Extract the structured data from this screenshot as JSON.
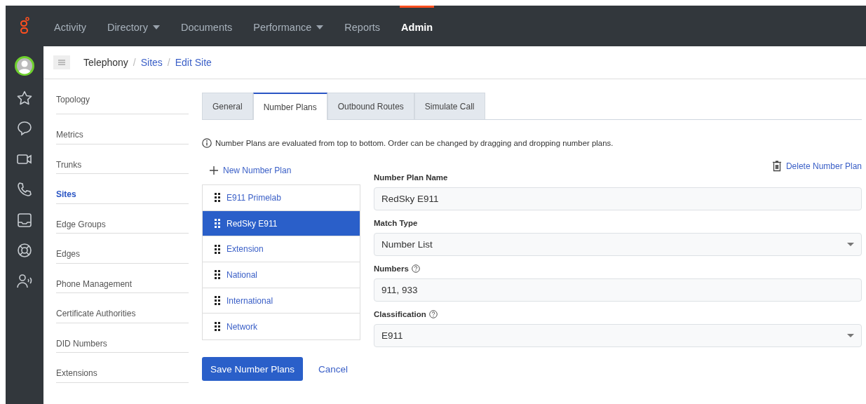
{
  "top_nav": [
    {
      "label": "Activity",
      "dropdown": false,
      "selected": false
    },
    {
      "label": "Directory",
      "dropdown": true,
      "selected": false
    },
    {
      "label": "Documents",
      "dropdown": false,
      "selected": false
    },
    {
      "label": "Performance",
      "dropdown": true,
      "selected": false
    },
    {
      "label": "Reports",
      "dropdown": false,
      "selected": false
    },
    {
      "label": "Admin",
      "dropdown": false,
      "selected": true
    }
  ],
  "breadcrumb": [
    {
      "label": "Telephony",
      "kind": "text"
    },
    {
      "label": "/",
      "kind": "separator"
    },
    {
      "label": "Sites",
      "kind": "link"
    },
    {
      "label": "/",
      "kind": "separator"
    },
    {
      "label": "Edit Site",
      "kind": "link"
    }
  ],
  "sidebar": {
    "items": [
      {
        "label": "Topology",
        "selected": false
      },
      {
        "label": "Metrics",
        "selected": false
      },
      {
        "label": "Trunks",
        "selected": false
      },
      {
        "label": "Sites",
        "selected": true
      },
      {
        "label": "Edge Groups",
        "selected": false
      },
      {
        "label": "Edges",
        "selected": false
      },
      {
        "label": "Phone Management",
        "selected": false
      },
      {
        "label": "Certificate Authorities",
        "selected": false
      },
      {
        "label": "DID Numbers",
        "selected": false
      },
      {
        "label": "Extensions",
        "selected": false
      }
    ]
  },
  "tabs": [
    {
      "label": "General",
      "selected": false
    },
    {
      "label": "Number Plans",
      "selected": true
    },
    {
      "label": "Outbound Routes",
      "selected": false
    },
    {
      "label": "Simulate Call",
      "selected": false
    }
  ],
  "info": "Number Plans are evaluated from top to bottom. Order can be changed by dragging and dropping number plans.",
  "new_plan": "New Number Plan",
  "plans": [
    {
      "label": "E911 Primelab",
      "selected": false
    },
    {
      "label": "RedSky E911",
      "selected": true
    },
    {
      "label": "Extension",
      "selected": false
    },
    {
      "label": "National",
      "selected": false
    },
    {
      "label": "International",
      "selected": false
    },
    {
      "label": "Network",
      "selected": false
    }
  ],
  "delete_plan": "Delete Number Plan",
  "form": [
    {
      "label": "Number Plan Name",
      "kind": "text",
      "help": false,
      "value": "RedSky E911"
    },
    {
      "label": "Match Type",
      "kind": "select",
      "help": false,
      "value": "Number List"
    },
    {
      "label": "Numbers",
      "kind": "text",
      "help": true,
      "value": "911, 933"
    },
    {
      "label": "Classification",
      "kind": "select",
      "help": true,
      "value": "E911"
    }
  ],
  "buttons": {
    "save": "Save Number Plans",
    "cancel": "Cancel"
  }
}
